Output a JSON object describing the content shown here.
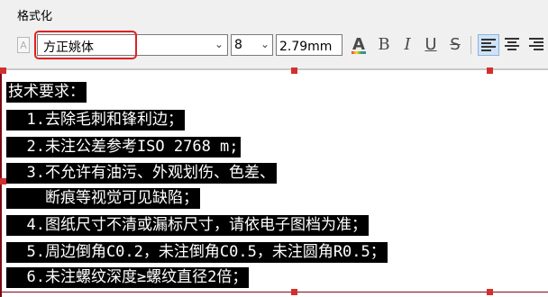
{
  "panel": {
    "title": "格式化"
  },
  "toolbar": {
    "font_value": "方正姚体",
    "size_value": "8",
    "height_value": "2.79mm",
    "color_label": "A",
    "bold_label": "B",
    "italic_label": "I",
    "underline_label": "U",
    "strike_label": "S",
    "align_options": [
      "align-left",
      "align-center",
      "align-right"
    ],
    "active_align": "align-left",
    "highlight_color": "#e02020"
  },
  "canvas": {
    "lines": [
      "技术要求：",
      "  1.去除毛刺和锋利边；",
      "  2.未注公差参考ISO 2768 m;",
      "  3.不允许有油污、外观划伤、色差、",
      "    断痕等视觉可见缺陷；",
      "  4.图纸尺寸不清或漏标尺寸，请依电子图档为准；",
      "  5.周边倒角C0.2，未注倒角C0.5，未注圆角R0.5；",
      "  6.未注螺纹深度≥螺纹直径2倍；"
    ]
  }
}
